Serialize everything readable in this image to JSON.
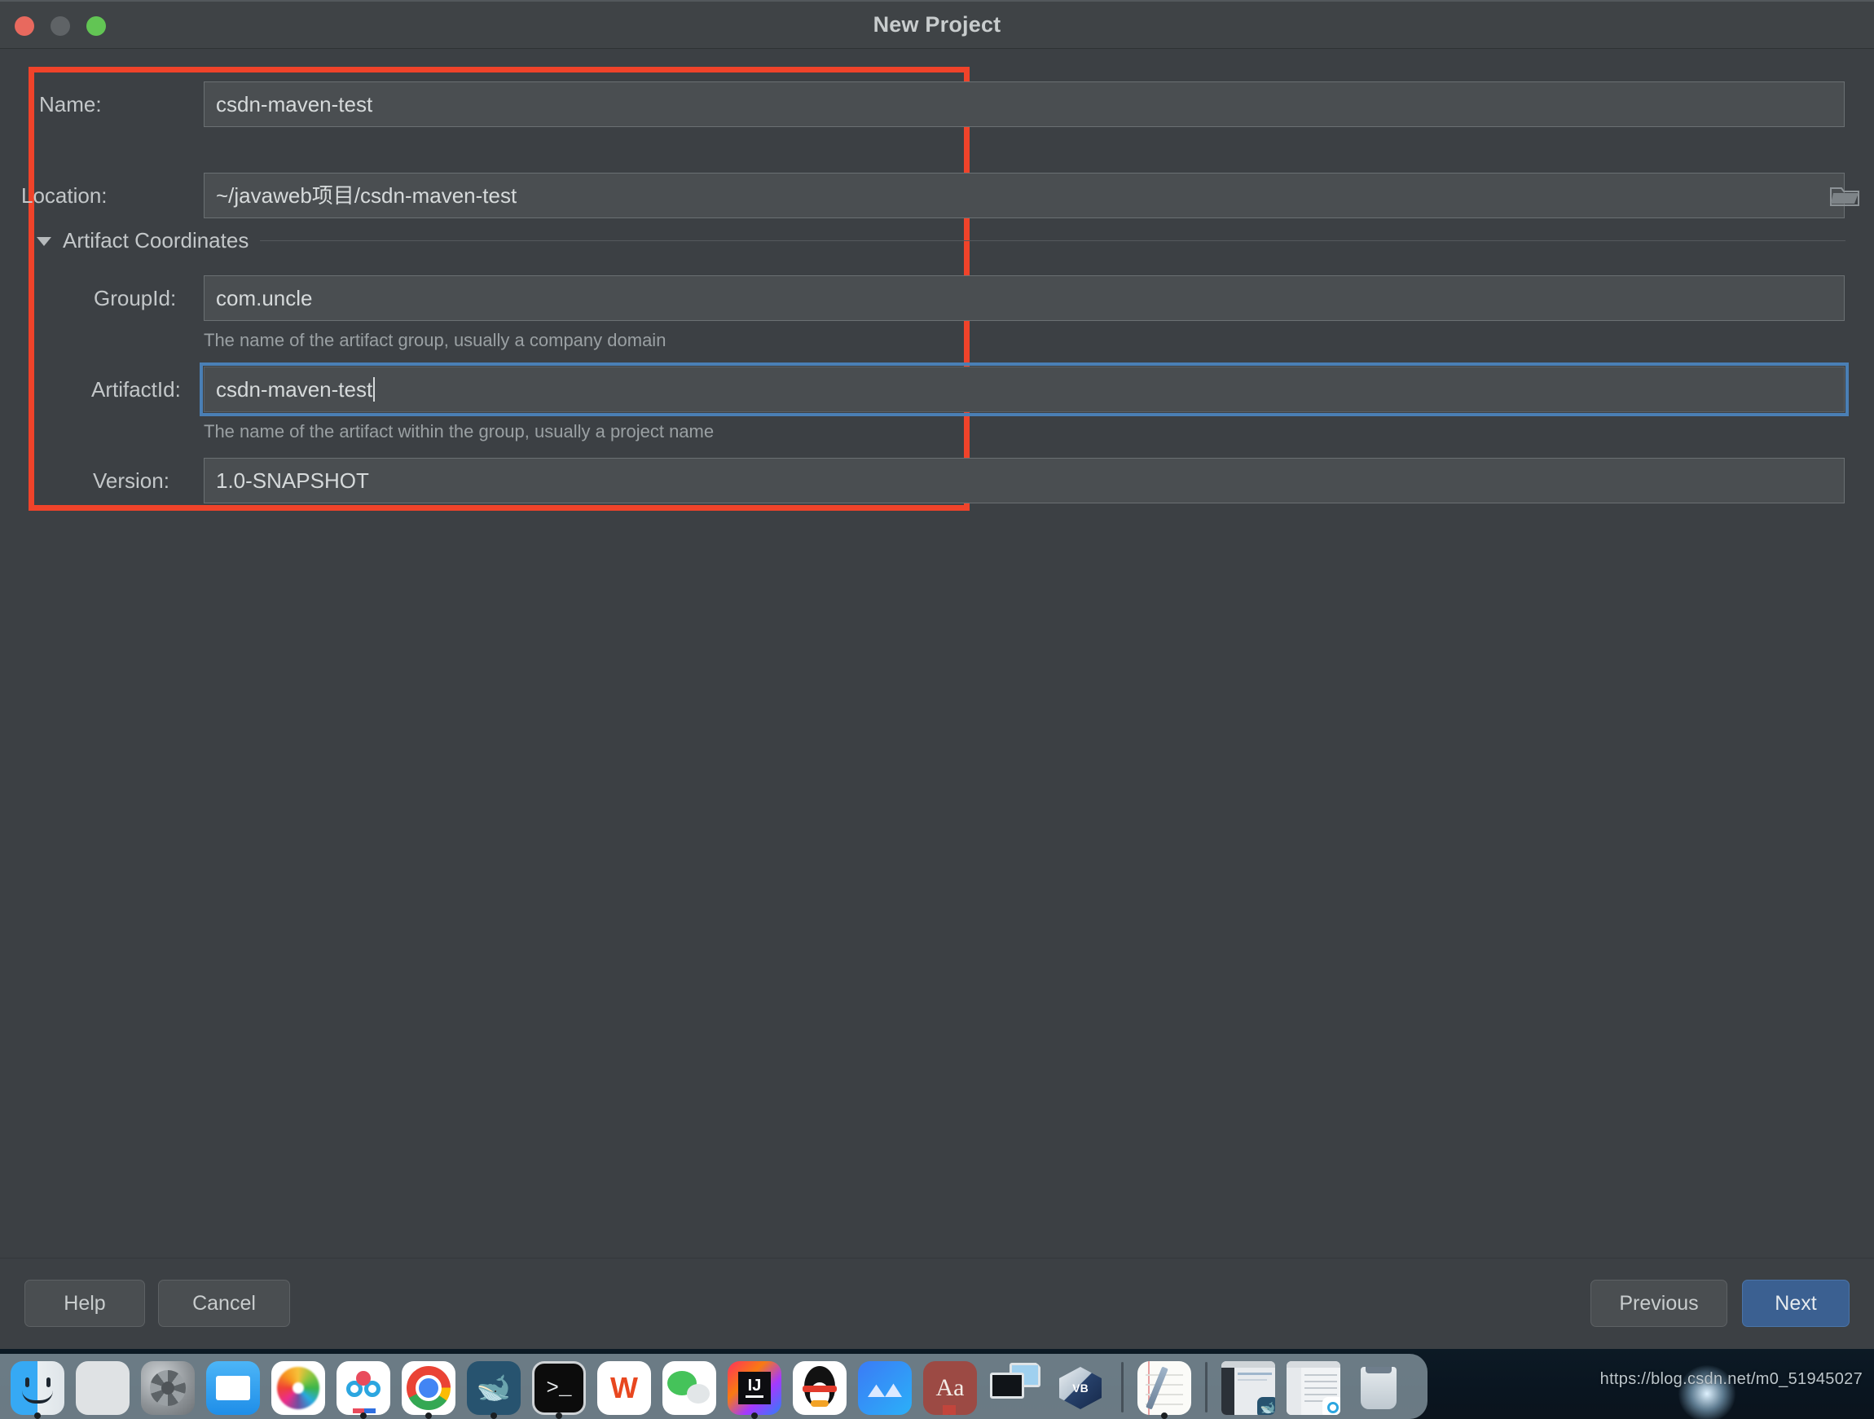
{
  "window": {
    "title": "New Project",
    "traffic_lights": [
      "close-red",
      "minimize-gray",
      "zoom-green"
    ]
  },
  "form": {
    "name": {
      "label": "Name:",
      "value": "csdn-maven-test"
    },
    "location": {
      "label": "Location:",
      "value": "~/javaweb项目/csdn-maven-test",
      "browse_icon": "folder-icon"
    },
    "section": {
      "label": "Artifact Coordinates",
      "expanded_icon": "triangle-down-icon"
    },
    "group_id": {
      "label": "GroupId:",
      "value": "com.uncle",
      "hint": "The name of the artifact group, usually a company domain"
    },
    "artifact_id": {
      "label": "ArtifactId:",
      "value": "csdn-maven-test",
      "hint": "The name of the artifact within the group, usually a project name",
      "focused": true
    },
    "version": {
      "label": "Version:",
      "value": "1.0-SNAPSHOT"
    }
  },
  "buttons": {
    "help": "Help",
    "cancel": "Cancel",
    "previous": "Previous",
    "next": "Next"
  },
  "colors": {
    "window_bg": "#3c4044",
    "field_bg": "#4a4e51",
    "accent_blue": "#3b6091",
    "focus_blue": "#4a7fb5",
    "annotation_red": "#f0432a"
  },
  "desktop": {
    "watermark": "https://blog.csdn.net/m0_51945027"
  },
  "dock": {
    "items": [
      {
        "name": "finder",
        "icon": "finder-icon",
        "running": true
      },
      {
        "name": "launchpad",
        "icon": "launchpad-icon",
        "running": false
      },
      {
        "name": "system-preferences",
        "icon": "gear-icon",
        "running": false
      },
      {
        "name": "mail",
        "icon": "mail-icon",
        "running": false
      },
      {
        "name": "photos",
        "icon": "photos-icon",
        "running": false
      },
      {
        "name": "baidu-netdisk",
        "icon": "baidu-netdisk-icon",
        "running": true
      },
      {
        "name": "google-chrome",
        "icon": "chrome-icon",
        "running": true
      },
      {
        "name": "mysql-workbench",
        "icon": "dolphin-icon",
        "running": true
      },
      {
        "name": "terminal",
        "icon": "terminal-icon",
        "running": true
      },
      {
        "name": "wps-office",
        "icon": "wps-icon",
        "running": false
      },
      {
        "name": "wechat",
        "icon": "wechat-icon",
        "running": false
      },
      {
        "name": "intellij-idea",
        "icon": "idea-icon",
        "running": true
      },
      {
        "name": "qq",
        "icon": "penguin-icon",
        "running": false
      },
      {
        "name": "xmind",
        "icon": "xmind-icon",
        "running": false
      },
      {
        "name": "dictionary",
        "icon": "dictionary-icon",
        "running": false
      },
      {
        "name": "screen-sharing",
        "icon": "display-icon",
        "running": false
      },
      {
        "name": "virtualbox",
        "icon": "virtualbox-icon",
        "running": false
      },
      {
        "name": "notes",
        "icon": "notes-icon",
        "running": true
      },
      {
        "name": "window-mysql-workbench",
        "icon": "minimized-window-icon",
        "running": false
      },
      {
        "name": "window-finder",
        "icon": "minimized-window-icon",
        "running": false
      },
      {
        "name": "trash",
        "icon": "trash-icon",
        "running": false
      }
    ]
  }
}
